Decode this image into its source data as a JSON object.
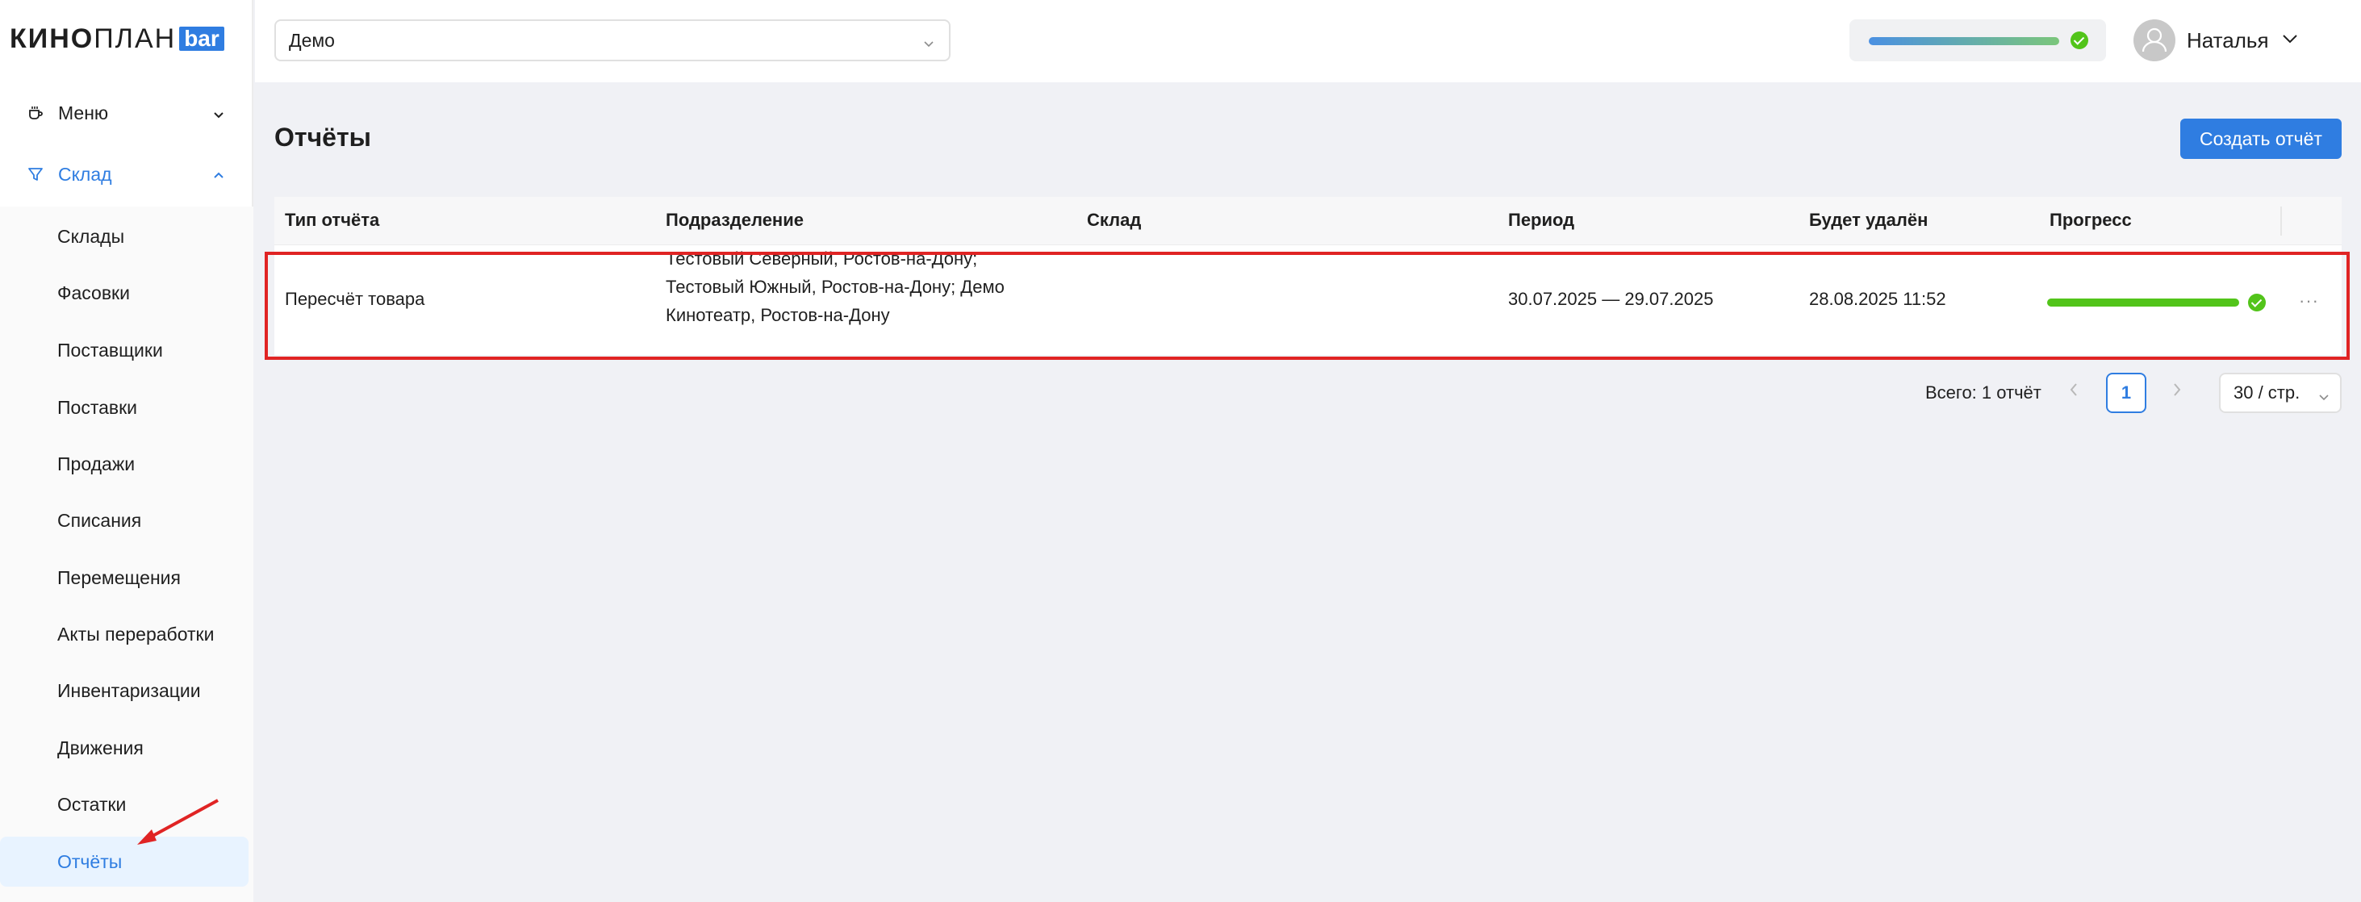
{
  "brand": {
    "logo_bold": "КИНО",
    "logo_regular": "ПЛАН",
    "logo_badge": "bar",
    "accent_color": "#2f7de1"
  },
  "sidebar": {
    "menu": {
      "label": "Меню",
      "icon": "coffee-cup-icon",
      "expanded": false
    },
    "sklad": {
      "label": "Склад",
      "icon": "funnel-icon",
      "expanded": true
    },
    "items": [
      {
        "label": "Склады"
      },
      {
        "label": "Фасовки"
      },
      {
        "label": "Поставщики"
      },
      {
        "label": "Поставки"
      },
      {
        "label": "Продажи"
      },
      {
        "label": "Списания"
      },
      {
        "label": "Перемещения"
      },
      {
        "label": "Акты переработки"
      },
      {
        "label": "Инвентаризации"
      },
      {
        "label": "Движения"
      },
      {
        "label": "Остатки"
      },
      {
        "label": "Отчёты",
        "active": true
      }
    ]
  },
  "header": {
    "org_select_value": "Демо",
    "sync_progress": 1.0,
    "sync_status": "success",
    "user_name": "Наталья"
  },
  "main": {
    "title": "Отчёты",
    "create_button": "Создать отчёт",
    "table": {
      "columns": [
        "Тип отчёта",
        "Подразделение",
        "Склад",
        "Период",
        "Будет удалён",
        "Прогресс"
      ],
      "rows": [
        {
          "type": "Пересчёт товара",
          "division_lines": [
            "Тестовый Северный, Ростов-на-Дону;",
            "Тестовый Южный, Ростов-на-Дону; Демо",
            "Кинотеатр, Ростов-на-Дону"
          ],
          "warehouse": "",
          "period": "30.07.2025 — 29.07.2025",
          "delete_at": "28.08.2025 11:52",
          "progress": 1.0,
          "progress_status": "success",
          "actions": "···"
        }
      ]
    },
    "pagination": {
      "total": "Всего: 1 отчёт",
      "current_page": "1",
      "page_size": "30 / стр."
    }
  },
  "colors": {
    "success": "#52c41a",
    "highlight": "#e02424",
    "primary": "#2f7de1"
  }
}
